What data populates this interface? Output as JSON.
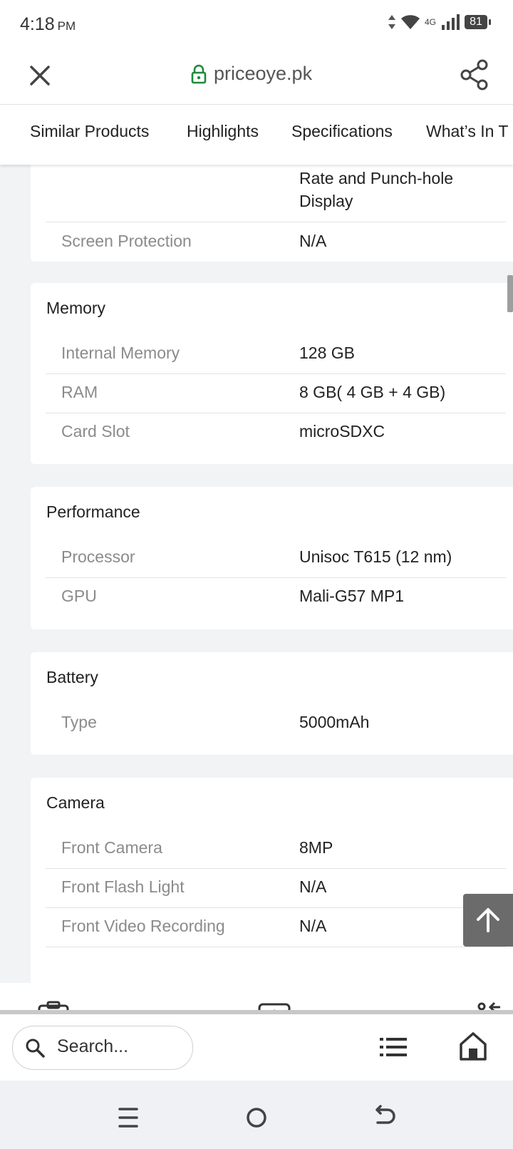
{
  "status": {
    "time": "4:18",
    "ampm": "PM",
    "network": "4G",
    "battery": "81"
  },
  "browser": {
    "url": "priceoye.pk"
  },
  "tabs": [
    "Similar Products",
    "Highlights",
    "Specifications",
    "What’s In T"
  ],
  "display_tail": {
    "value_lines": [
      "Rate and Punch-hole",
      "Display"
    ],
    "rows": [
      {
        "label": "Screen Protection",
        "value": "N/A"
      }
    ]
  },
  "sections": [
    {
      "title": "Memory",
      "rows": [
        {
          "label": "Internal Memory",
          "value": "128 GB"
        },
        {
          "label": "RAM",
          "value": "8 GB( 4 GB + 4 GB)"
        },
        {
          "label": "Card Slot",
          "value": "microSDXC"
        }
      ]
    },
    {
      "title": "Performance",
      "rows": [
        {
          "label": "Processor",
          "value": "Unisoc T615 (12 nm)"
        },
        {
          "label": "GPU",
          "value": "Mali-G57 MP1"
        }
      ]
    },
    {
      "title": "Battery",
      "rows": [
        {
          "label": "Type",
          "value": "5000mAh"
        }
      ]
    },
    {
      "title": "Camera",
      "rows": [
        {
          "label": "Front Camera",
          "value": "8MP"
        },
        {
          "label": "Front Flash Light",
          "value": "N/A"
        },
        {
          "label": "Front Video Recording",
          "value": "N/A"
        }
      ]
    }
  ],
  "bottom_bar": {
    "search_placeholder": "Search..."
  },
  "icons": {
    "close": "close-icon",
    "lock": "lock-icon",
    "share": "share-icon",
    "back_to_top": "arrow-up-icon",
    "search": "search-icon",
    "list": "list-icon",
    "home": "home-icon",
    "nav_recents": "recents-icon",
    "nav_home": "circle-home-icon",
    "nav_back": "back-icon"
  },
  "colors": {
    "lock_green": "#1e8a3c",
    "back_top_bg": "#6b6b6b"
  }
}
